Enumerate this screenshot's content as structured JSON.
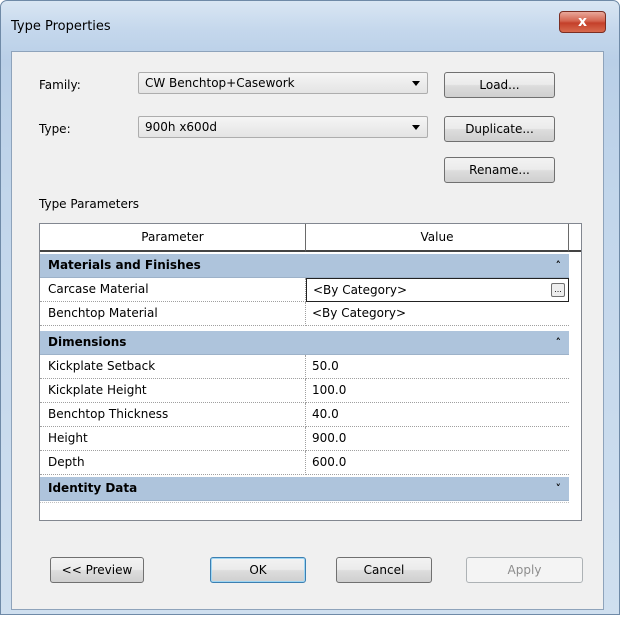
{
  "window": {
    "title": "Type Properties",
    "close_label": "x"
  },
  "family": {
    "label": "Family:",
    "value": "CW Benchtop+Casework"
  },
  "type": {
    "label": "Type:",
    "value": "900h x600d"
  },
  "buttons": {
    "load": "Load...",
    "duplicate": "Duplicate...",
    "rename": "Rename...",
    "preview": "<< Preview",
    "ok": "OK",
    "cancel": "Cancel",
    "apply": "Apply"
  },
  "type_parameters": {
    "section_label": "Type Parameters",
    "columns": [
      "Parameter",
      "Value"
    ],
    "groups": [
      {
        "name": "Materials and Finishes",
        "expanded": true,
        "rows": [
          {
            "parameter": "Carcase Material",
            "value": "<By Category>"
          },
          {
            "parameter": "Benchtop Material",
            "value": "<By Category>"
          }
        ]
      },
      {
        "name": "Dimensions",
        "expanded": true,
        "rows": [
          {
            "parameter": "Kickplate Setback",
            "value": "50.0"
          },
          {
            "parameter": "Kickplate Height",
            "value": "100.0"
          },
          {
            "parameter": "Benchtop Thickness",
            "value": "40.0"
          },
          {
            "parameter": "Height",
            "value": "900.0"
          },
          {
            "parameter": "Depth",
            "value": "600.0"
          }
        ]
      },
      {
        "name": "Identity Data",
        "expanded": false,
        "rows": []
      }
    ],
    "collapse_glyph": "˄",
    "expand_glyph": "˅",
    "ellipsis_label": "..."
  }
}
